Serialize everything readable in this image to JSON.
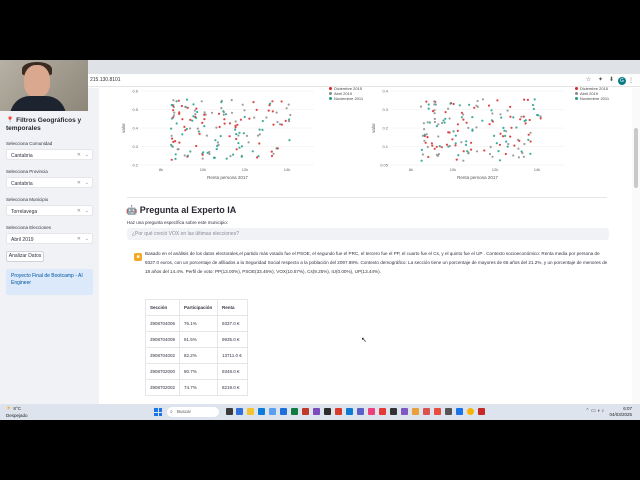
{
  "browser": {
    "url": "215.130.8101",
    "profile_initial": "G"
  },
  "sidebar": {
    "title": "Filtros Geográficos y temporales",
    "filters": [
      {
        "label": "Selecciona Comunidad",
        "value": "Cantabria"
      },
      {
        "label": "Selecciona Provincia",
        "value": "Cantabria"
      },
      {
        "label": "Selecciona Municipio",
        "value": "Torrelavega"
      },
      {
        "label": "Selecciona Elecciones",
        "value": "Abril 2019"
      }
    ],
    "analyze_label": "Analizar Datos",
    "project_note": "Proyecto Final de Bootcamp - AI Engineer"
  },
  "charts": {
    "left": {
      "xlabel": "Renta persona 2017",
      "ylabel": "valor",
      "xticks": [
        "8k",
        "10k",
        "12k",
        "14k"
      ],
      "yticks": [
        "0.6",
        "0.5",
        "0.4",
        "0.3",
        "0.2"
      ],
      "legend": [
        {
          "name": "Diciembre 2015",
          "color": "#d62728"
        },
        {
          "name": "Abril 2019",
          "color": "#8c8c8c"
        },
        {
          "name": "Noviembre 2011",
          "color": "#1f9e89"
        }
      ]
    },
    "right": {
      "xlabel": "Renta persona 2017",
      "ylabel": "valor",
      "xticks": [
        "8k",
        "10k",
        "12k",
        "14k"
      ],
      "yticks": [
        "0.4",
        "0.3",
        "0.2",
        "0.1",
        "0.05"
      ],
      "legend": [
        {
          "name": "Diciembre 2015",
          "color": "#d62728"
        },
        {
          "name": "Abril 2019",
          "color": "#8c8c8c"
        },
        {
          "name": "Noviembre 2011",
          "color": "#1f9e89"
        }
      ]
    }
  },
  "ai": {
    "heading": "Pregunta al Experto IA",
    "prompt_label": "Haz una pregunta específica sobre este municipio:",
    "placeholder": "¿Por qué creció VOX en las últimas elecciones?",
    "answer": "Basado en el análisis de los datos electorales,el partido más votado fue el PSOE, el segundo fue el PRC, el tercero fue el PP, el cuarto fue el Cs, y el quinto fue el UP . Contexto socioeconómico: Renta media por persona de 9327.0 euros, con un porcentaje de afiliados a la Seguridad Social respecto a la población del 2097.98%. Contexto demográfico: La sección tiene un porcentaje de mayores de 65 años del 21.2%, y un porcentaje de menores de 18 años del 14.4%. Perfil de voto: PP(13.00%), PSOE(33.46%), VOX(10.57%), Cs(9.25%), IU(0.00%), UP(13.44%).",
    "table": {
      "headers": [
        "Sección",
        "Participación",
        "Renta"
      ],
      "rows": [
        [
          "3908704006",
          "76.1%",
          "9337.0 €"
        ],
        [
          "3908704009",
          "81.5%",
          "9935.0 €"
        ],
        [
          "3908704002",
          "82.2%",
          "13711.0 €"
        ],
        [
          "3908702000",
          "80.7%",
          "9348.0 €"
        ],
        [
          "3908702002",
          "74.7%",
          "8219.0 €"
        ]
      ]
    }
  },
  "taskbar": {
    "weather_temp": "8°C",
    "weather_desc": "Despejado",
    "search_placeholder": "Buscar",
    "time": "6:07",
    "date": "04/03/2025"
  }
}
